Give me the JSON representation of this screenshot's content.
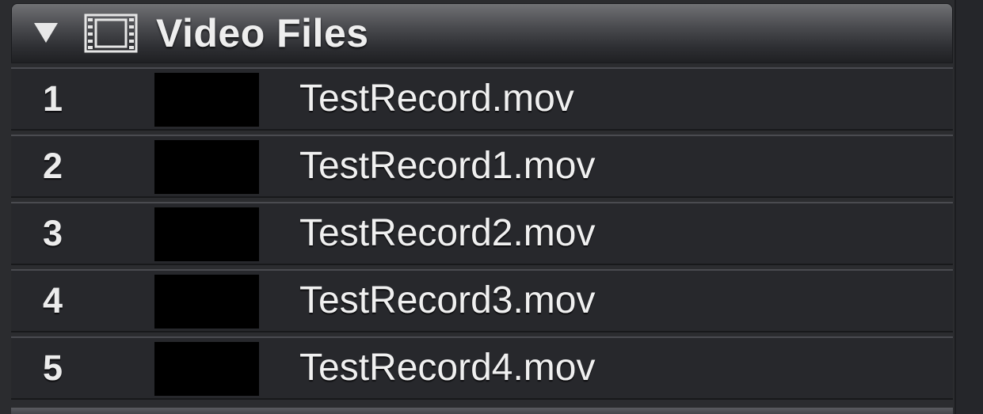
{
  "group": {
    "title": "Video Files",
    "disclosure_icon": "triangle-down-icon",
    "type_icon": "film-strip-icon"
  },
  "files": [
    {
      "index": "1",
      "name": "TestRecord.mov"
    },
    {
      "index": "2",
      "name": "TestRecord1.mov"
    },
    {
      "index": "3",
      "name": "TestRecord2.mov"
    },
    {
      "index": "4",
      "name": "TestRecord3.mov"
    },
    {
      "index": "5",
      "name": "TestRecord4.mov"
    }
  ],
  "colors": {
    "background": "#2b2c2f",
    "row": "#27282c",
    "text": "#f0f0f0",
    "thumbnail": "#000000"
  }
}
